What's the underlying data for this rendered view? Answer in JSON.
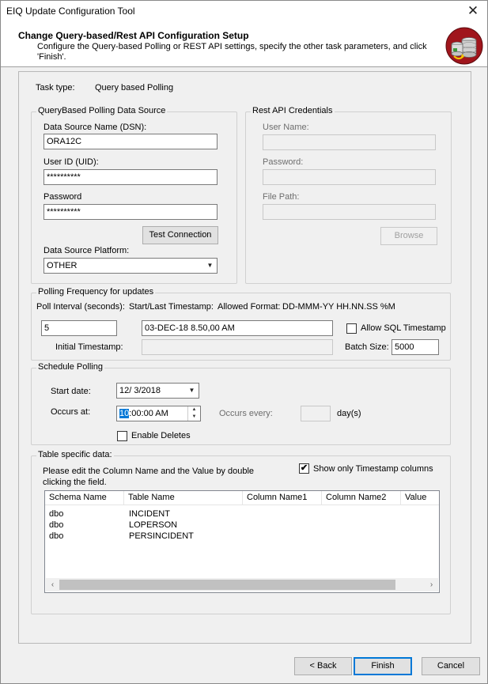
{
  "window": {
    "title": "EIQ Update Configuration Tool",
    "close_glyph": "✕"
  },
  "header": {
    "title": "Change Query-based/Rest API Configuration Setup",
    "description": "Configure the Query-based Polling or REST API settings, specify the other task parameters, and click 'Finish'.",
    "logo_icon": "database-sync-icon"
  },
  "task": {
    "label": "Task type:",
    "value": "Query based Polling"
  },
  "query_source": {
    "legend": "QueryBased Polling Data Source",
    "dsn_label": "Data Source Name (DSN):",
    "dsn_value": "ORA12C",
    "uid_label": "User ID (UID):",
    "uid_value": "**********",
    "password_label": "Password",
    "password_value": "**********",
    "test_button": "Test Connection",
    "platform_label": "Data Source Platform:",
    "platform_value": "OTHER"
  },
  "rest_api": {
    "legend": "Rest API Credentials",
    "username_label": "User Name:",
    "password_label": "Password:",
    "filepath_label": "File Path:",
    "browse_button": "Browse"
  },
  "polling": {
    "legend": "Polling Frequency for updates",
    "interval_label": "Poll Interval (seconds):",
    "interval_value": "5",
    "timestamp_label": "Start/Last Timestamp:",
    "format_label": "Allowed Format:",
    "format_value": "DD-MMM-YY HH.NN.SS %M",
    "timestamp_value": "03-DEC-18 8.50,00 AM",
    "allow_sql_label": "Allow SQL Timestamp",
    "allow_sql_checked": false,
    "initial_label": "Initial Timestamp:",
    "initial_value": "",
    "batch_label": "Batch Size:",
    "batch_value": "5000"
  },
  "schedule": {
    "legend": "Schedule Polling",
    "start_label": "Start date:",
    "start_value": "12/  3/2018",
    "occurs_label": "Occurs at:",
    "occurs_hour": "10",
    "occurs_rest": ":00:00 AM",
    "every_label": "Occurs every:",
    "every_value": "",
    "days_label": "day(s)",
    "deletes_label": "Enable Deletes",
    "deletes_checked": false
  },
  "table_data": {
    "legend": "Table specific data:",
    "instruction": "Please edit the Column Name and the Value by double clicking the field.",
    "show_ts_label": "Show only Timestamp columns",
    "show_ts_checked": true,
    "check_glyph": "✔",
    "columns": [
      "Schema Name",
      "Table Name",
      "Column Name1",
      "Column Name2",
      "Value"
    ],
    "rows": [
      [
        "dbo",
        "INCIDENT"
      ],
      [
        "dbo",
        "LOPERSON"
      ],
      [
        "dbo",
        "PERSINCIDENT"
      ]
    ]
  },
  "footer": {
    "back": "< Back",
    "finish": "Finish",
    "cancel": "Cancel"
  },
  "glyphs": {
    "dropdown": "▼",
    "up": "▲",
    "down": "▼",
    "left": "‹",
    "right": "›"
  },
  "colors": {
    "accent": "#0078d7",
    "logo_red": "#a0151c"
  }
}
